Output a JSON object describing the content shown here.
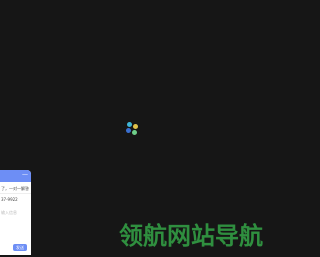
{
  "chat": {
    "close": "—",
    "msg1": "了，一对一解答",
    "msg2": "37-9922",
    "msg3": "输入信息",
    "send": "发送"
  },
  "brand": {
    "text": "领航网站导航"
  }
}
